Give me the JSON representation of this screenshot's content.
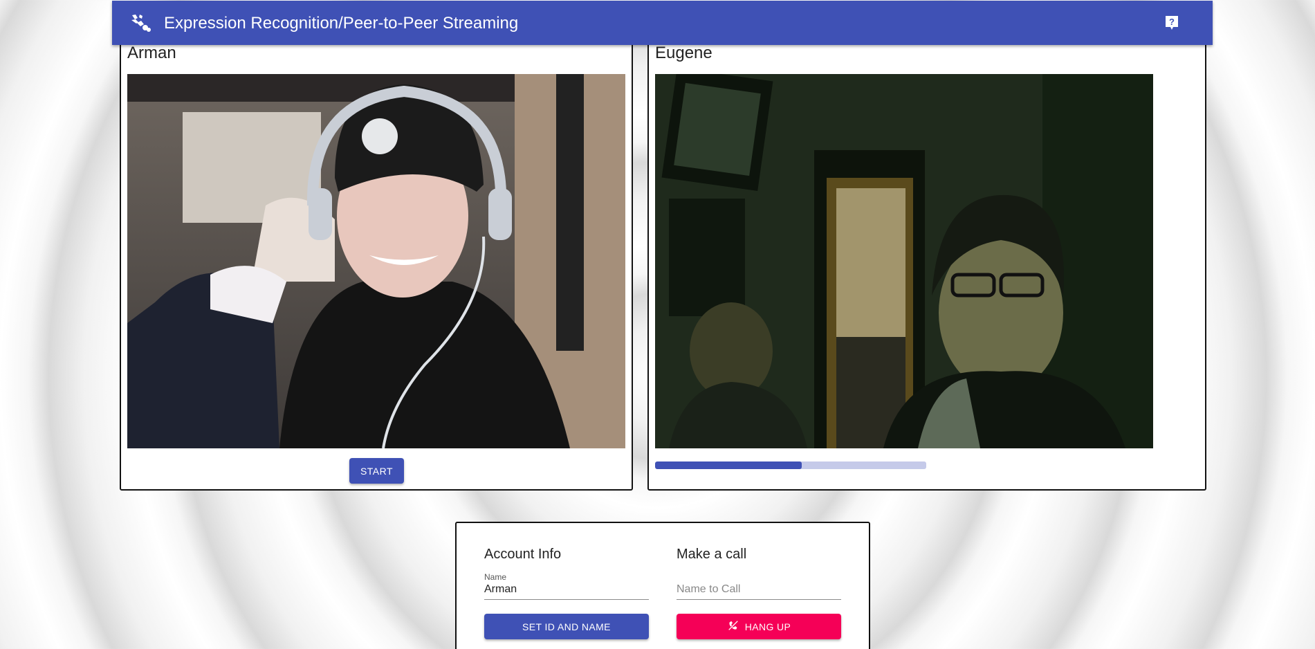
{
  "header": {
    "title": "Expression Recognition/Peer-to-Peer Streaming",
    "logo_icon": "sign-language-icon",
    "help_icon": "help-icon",
    "color": "#3f51b5"
  },
  "local": {
    "name": "Arman",
    "start_label": "START"
  },
  "remote": {
    "name": "Eugene",
    "progress_percent": 54
  },
  "account": {
    "title": "Account Info",
    "name_label": "Name",
    "name_value": "Arman",
    "button_label": "SET ID AND NAME"
  },
  "call": {
    "title": "Make a call",
    "placeholder": "Name to Call",
    "hangup_label": "HANG UP",
    "hangup_icon": "call-end-icon",
    "color": "#f50057"
  }
}
